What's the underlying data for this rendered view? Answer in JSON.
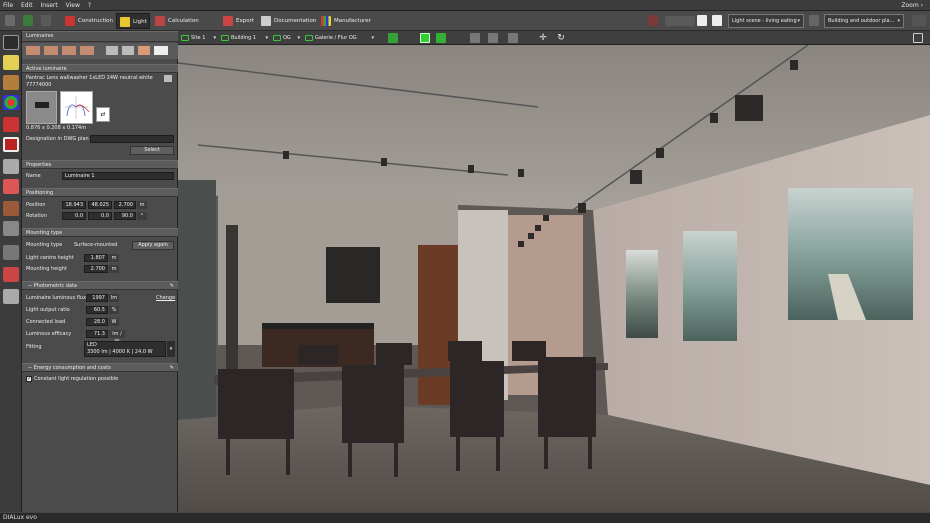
{
  "menu": {
    "items": [
      "File",
      "Edit",
      "Insert",
      "View",
      "?"
    ],
    "zoom": "Zoom ›"
  },
  "main_tabs": [
    {
      "label": "Construction",
      "icon": "construction-icon"
    },
    {
      "label": "Light",
      "icon": "light-icon",
      "active": true
    },
    {
      "label": "Calculation objects",
      "icon": "calculation-icon"
    },
    {
      "label": "Export",
      "icon": "export-icon"
    },
    {
      "label": "Documentation",
      "icon": "documentation-icon"
    },
    {
      "label": "Manufacturer",
      "icon": "manufacturer-icon"
    }
  ],
  "topright": {
    "light_scene": "Light scene - living eating",
    "building": "Building and outdoor pla..."
  },
  "panel": {
    "title": "Luminaires",
    "active_luminaire": {
      "header": "Active luminaire",
      "name": "Pantrac Lens wallwasher 1xLED 24W neutral white",
      "code": "77774000",
      "dims": "0.876 x 0.208 x 0.174m",
      "designation_label": "Designation in DWG plan",
      "select_btn": "Select"
    },
    "properties": {
      "header": "Properties",
      "name_label": "Name",
      "name_value": "Luminaire 1"
    },
    "positioning": {
      "header": "Positioning",
      "position_label": "Position",
      "position": [
        "18.943",
        "48.025",
        "2.700"
      ],
      "position_unit": "m",
      "rotation_label": "Rotation",
      "rotation": [
        "0.0",
        "0.0",
        "90.0"
      ],
      "rotation_unit": "°"
    },
    "mounting": {
      "header": "Mounting type",
      "type_label": "Mounting type",
      "type_value": "Surface-mounted",
      "apply_btn": "Apply again",
      "centre_label": "Light centre height",
      "centre_value": "1.807",
      "mounting_label": "Mounting height",
      "mounting_value": "2.700",
      "unit": "m"
    },
    "photometric": {
      "header": "Photometric data",
      "flux_label": "Luminaire luminous flux",
      "flux_value": "1997",
      "flux_unit": "lm",
      "change_link": "Change",
      "lor_label": "Light output ratio",
      "lor_value": "60.5",
      "lor_unit": "%",
      "load_label": "Connected load",
      "load_value": "28.0",
      "load_unit": "W",
      "efficacy_label": "Luminous efficacy",
      "efficacy_value": "71.3",
      "efficacy_unit": "lm / W",
      "fitting_label": "Fitting",
      "fitting_type": "LED",
      "fitting_specs": "3300 lm  |  4000 K  |  24.0 W"
    },
    "energy": {
      "header": "Energy consumption and costs",
      "checkbox_label": "Constant light regulation possible",
      "checked": true
    }
  },
  "view_toolbar": {
    "site": "Site 1",
    "building": "Building 1",
    "storey": "OG",
    "level": "Galerie / Flur OG"
  },
  "status": "DIALux evo",
  "colors": {
    "accent_active": "#2e9e3a",
    "selection": "#7fd13b",
    "panel_bg": "#4b4b4b"
  }
}
